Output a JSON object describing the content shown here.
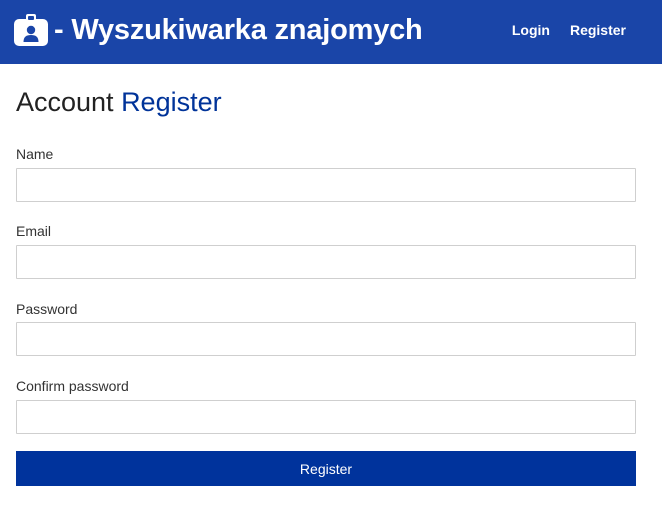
{
  "colors": {
    "navbar": "#1a45a8",
    "accent": "#003399",
    "button": "#00339c",
    "input_border": "#cfcfcf"
  },
  "header": {
    "brand_icon": "id-badge-icon",
    "brand_text": "- Wyszukiwarka znajomych",
    "nav": [
      {
        "label": "Login"
      },
      {
        "label": "Register"
      }
    ]
  },
  "main": {
    "title_prefix": "Account ",
    "title_accent": "Register",
    "fields": [
      {
        "label": "Name",
        "value": "",
        "placeholder": ""
      },
      {
        "label": "Email",
        "value": "",
        "placeholder": ""
      },
      {
        "label": "Password",
        "value": "",
        "placeholder": ""
      },
      {
        "label": "Confirm password",
        "value": "",
        "placeholder": ""
      }
    ],
    "submit_label": "Register"
  }
}
